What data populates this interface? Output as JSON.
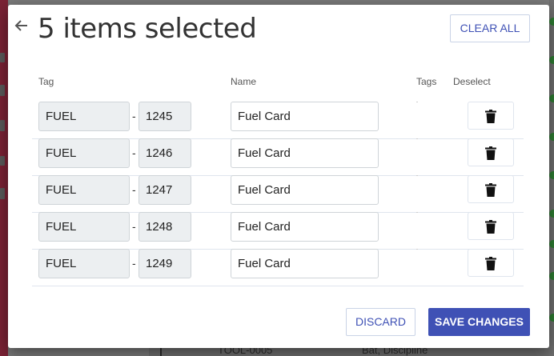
{
  "dialog": {
    "title": "5 items selected",
    "clear_all_label": "CLEAR ALL",
    "discard_label": "DISCARD",
    "save_label": "SAVE CHANGES"
  },
  "columns": {
    "tag": "Tag",
    "name": "Name",
    "tags": "Tags",
    "deselect": "Deselect"
  },
  "rows": [
    {
      "prefix": "FUEL",
      "number": "1245",
      "name": "Fuel Card"
    },
    {
      "prefix": "FUEL",
      "number": "1246",
      "name": "Fuel Card"
    },
    {
      "prefix": "FUEL",
      "number": "1247",
      "name": "Fuel Card"
    },
    {
      "prefix": "FUEL",
      "number": "1248",
      "name": "Fuel Card"
    },
    {
      "prefix": "FUEL",
      "number": "1249",
      "name": "Fuel Card"
    }
  ],
  "separator": "-",
  "background": {
    "tool_code": "TOOL-0005",
    "tool_name": "Bat, Discipline"
  },
  "colors": {
    "accent": "#3f51b5",
    "sidebar": "#7b2235"
  },
  "icons": {
    "back": "arrow-left-icon",
    "delete": "trash-icon"
  }
}
